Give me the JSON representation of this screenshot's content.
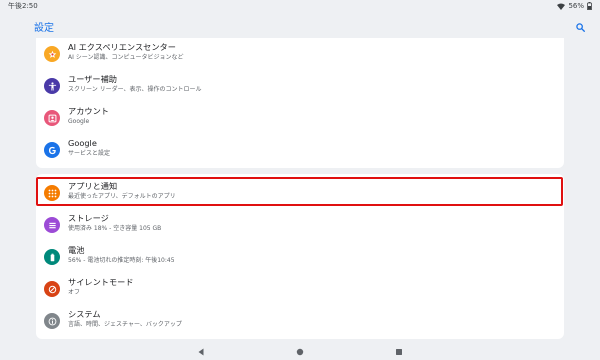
{
  "status_bar": {
    "time": "午後2:50",
    "battery": "56%"
  },
  "app_bar": {
    "title": "設定"
  },
  "colors": {
    "accent": "#1a73e8",
    "highlight": "#e01010",
    "ai": "#f9a825",
    "accessibility": "#4a3aa8",
    "accounts": "#e8577a",
    "google": "#1a73e8",
    "apps": "#f57c00",
    "storage": "#9c4bd6",
    "battery": "#00897b",
    "silent": "#d84315",
    "system": "#80868b"
  },
  "items": [
    {
      "title": "AI エクスペリエンスセンター",
      "subtitle": "AI シーン認識、コンピュータビジョンなど",
      "icon": "star-icon"
    },
    {
      "title": "ユーザー補助",
      "subtitle": "スクリーン リーダー、表示、操作のコントロール",
      "icon": "accessibility-icon"
    },
    {
      "title": "アカウント",
      "subtitle": "Google",
      "icon": "account-icon"
    },
    {
      "title": "Google",
      "subtitle": "サービスと設定",
      "icon": "google-icon"
    },
    {
      "title": "アプリと通知",
      "subtitle": "最近使ったアプリ、デフォルトのアプリ",
      "icon": "apps-grid-icon"
    },
    {
      "title": "ストレージ",
      "subtitle": "使用済み 18% - 空き容量 105 GB",
      "icon": "storage-icon"
    },
    {
      "title": "電池",
      "subtitle": "56% - 電池切れの推定時刻: 午後10:45",
      "icon": "battery-icon"
    },
    {
      "title": "サイレントモード",
      "subtitle": "オフ",
      "icon": "do-not-disturb-icon"
    },
    {
      "title": "システム",
      "subtitle": "言語、時間、ジェスチャー、バックアップ",
      "icon": "info-icon"
    }
  ]
}
